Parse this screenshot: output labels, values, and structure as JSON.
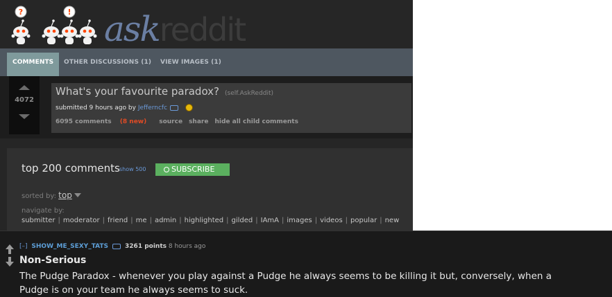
{
  "header": {
    "logo_word_1": "ask",
    "logo_word_2": "reddit",
    "alien_bubbles": [
      "?",
      "!"
    ]
  },
  "tabs": [
    {
      "label": "COMMENTS",
      "selected": true
    },
    {
      "label": "OTHER DISCUSSIONS (1)",
      "selected": false
    },
    {
      "label": "VIEW IMAGES (1)",
      "selected": false
    }
  ],
  "post": {
    "score": "4072",
    "title": "What's your favourite paradox?",
    "domain": "(self.AskReddit)",
    "tagline_prefix": "submitted 9 hours ago by",
    "author": "Jefferncfc",
    "buttons": {
      "comments": "6095 comments",
      "new": "(8 new)",
      "source": "source",
      "share": "share",
      "hide": "hide all child comments"
    }
  },
  "comment_area": {
    "heading": "top 200 comments",
    "show_more": "show 500",
    "subscribe": "SUBSCRIBE",
    "sorted_by_label": "sorted by:",
    "sorted_by_value": "top",
    "navigate_label": "navigate by:",
    "navigate_links": [
      "submitter",
      "moderator",
      "friend",
      "me",
      "admin",
      "highlighted",
      "gilded",
      "IAmA",
      "images",
      "videos",
      "popular",
      "new"
    ]
  },
  "comment": {
    "toggle": "[–]",
    "user": "SHOW_ME_SEXY_TATS",
    "points": "3261 points",
    "time": "8 hours ago",
    "title": "Non-Serious",
    "body": "The Pudge Paradox - whenever you play against a Pudge he always seems to be killing it but, conversely, when a Pudge is on your team he always seems to suck."
  },
  "colors": {
    "accent_blue": "#6b9ad9",
    "subscribe_green": "#5bb05f",
    "new_orange": "#e04b25",
    "selected_tab": "#7f9a9c"
  }
}
